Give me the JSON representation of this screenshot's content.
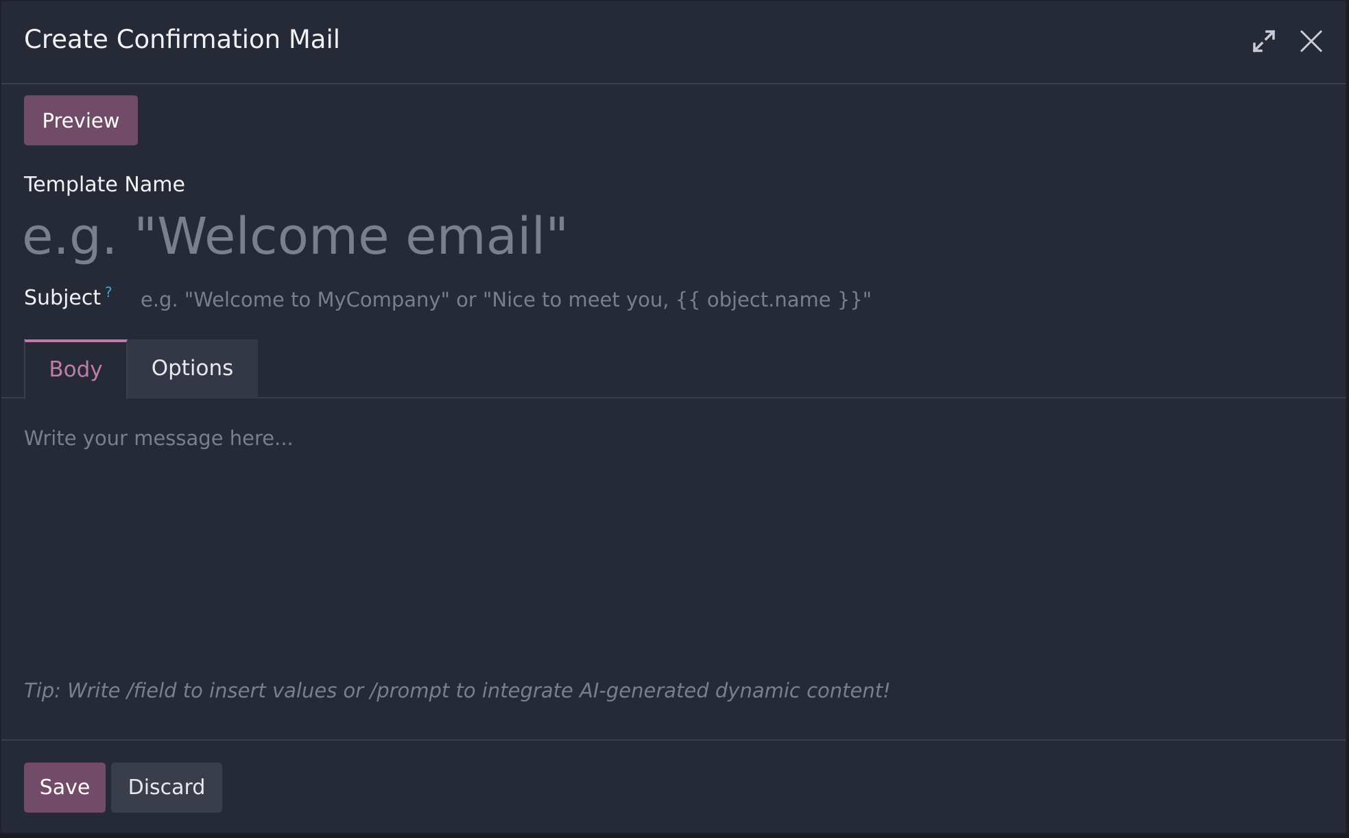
{
  "dialog": {
    "title": "Create Confirmation Mail"
  },
  "toolbar": {
    "preview_label": "Preview"
  },
  "form": {
    "template_name_label": "Template Name",
    "template_name_placeholder": "e.g. \"Welcome email\"",
    "template_name_value": "",
    "subject_label": "Subject",
    "subject_help": "?",
    "subject_placeholder": "e.g. \"Welcome to MyCompany\" or \"Nice to meet you, {{ object.name }}\"",
    "subject_value": ""
  },
  "tabs": [
    {
      "label": "Body",
      "active": true
    },
    {
      "label": "Options",
      "active": false
    }
  ],
  "editor": {
    "placeholder": "Write your message here...",
    "tip": "Tip: Write /field to insert values or /prompt to integrate AI-generated dynamic content!"
  },
  "footer": {
    "save_label": "Save",
    "discard_label": "Discard"
  },
  "icons": {
    "expand": "expand-icon",
    "close": "close-icon"
  },
  "colors": {
    "accent": "#714b67",
    "active_tab": "#c17cab",
    "background": "#262a36",
    "help": "#4f9fe0"
  }
}
